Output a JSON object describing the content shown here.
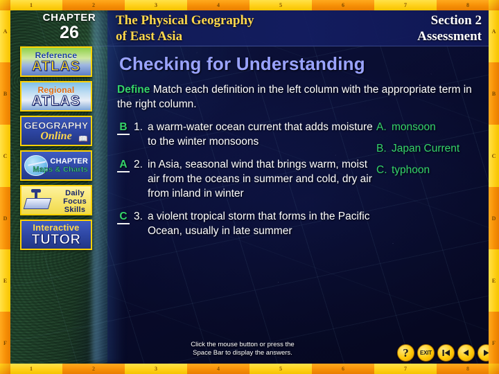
{
  "window": {
    "ruler_top": [
      "1",
      "2",
      "3",
      "4",
      "5",
      "6",
      "7",
      "8"
    ],
    "ruler_bottom": [
      "1",
      "2",
      "3",
      "4",
      "5",
      "6",
      "7",
      "8"
    ],
    "ruler_left": [
      "A",
      "B",
      "C",
      "D",
      "E",
      "F"
    ],
    "ruler_right": [
      "A",
      "B",
      "C",
      "D",
      "E",
      "F"
    ],
    "accent_yellow": "#ffd019",
    "accent_orange": "#f78f06"
  },
  "banner": {
    "chapter_word": "CHAPTER",
    "chapter_number": "26",
    "title_line1": "The Physical Geography",
    "title_line2": "of East Asia",
    "section_line1": "Section 2",
    "section_line2": "Assessment",
    "title_color": "#ffd84d"
  },
  "sidebar": {
    "buttons": [
      {
        "name": "reference-atlas",
        "line1": "Reference",
        "line2": "ATLAS"
      },
      {
        "name": "regional-atlas",
        "line1": "Regional",
        "line2": "ATLAS"
      },
      {
        "name": "geography-online",
        "line1": "GEOGRAPHY",
        "line2": "Online"
      },
      {
        "name": "chapter-maps-charts",
        "line1": "CHAPTER",
        "line2": "Maps & Charts"
      },
      {
        "name": "daily-focus-skills",
        "line1": "Daily",
        "line2": "Focus",
        "line3": "Skills"
      },
      {
        "name": "interactive-tutor",
        "line1": "Interactive",
        "line2": "TUTOR"
      }
    ]
  },
  "main": {
    "page_title": "Checking for Understanding",
    "define_label": "Define",
    "define_instructions": "Match each definition in the left column with the appropriate term in the right column.",
    "definitions": [
      {
        "answer": "B",
        "number": "1.",
        "text": "a warm-water ocean current that adds moisture to the winter monsoons"
      },
      {
        "answer": "A",
        "number": "2.",
        "text": "in Asia, seasonal wind that brings warm, moist air from the oceans in summer and cold, dry air from inland in winter"
      },
      {
        "answer": "C",
        "number": "3.",
        "text": "a violent tropical storm that forms in the Pacific Ocean, usually in late summer"
      }
    ],
    "terms": [
      {
        "letter": "A.",
        "term": "monsoon"
      },
      {
        "letter": "B.",
        "term": "Japan Current"
      },
      {
        "letter": "C.",
        "term": "typhoon"
      }
    ],
    "answer_color": "#35d46a",
    "title_color": "#9aa3ff"
  },
  "footer": {
    "hint_line1": "Click the mouse button or press the",
    "hint_line2": "Space Bar to display the answers.",
    "nav": [
      {
        "name": "help-button",
        "label": "?"
      },
      {
        "name": "exit-button",
        "label": "EXIT"
      },
      {
        "name": "first-slide-button",
        "label": ""
      },
      {
        "name": "previous-slide-button",
        "label": ""
      },
      {
        "name": "next-slide-button",
        "label": ""
      }
    ]
  }
}
